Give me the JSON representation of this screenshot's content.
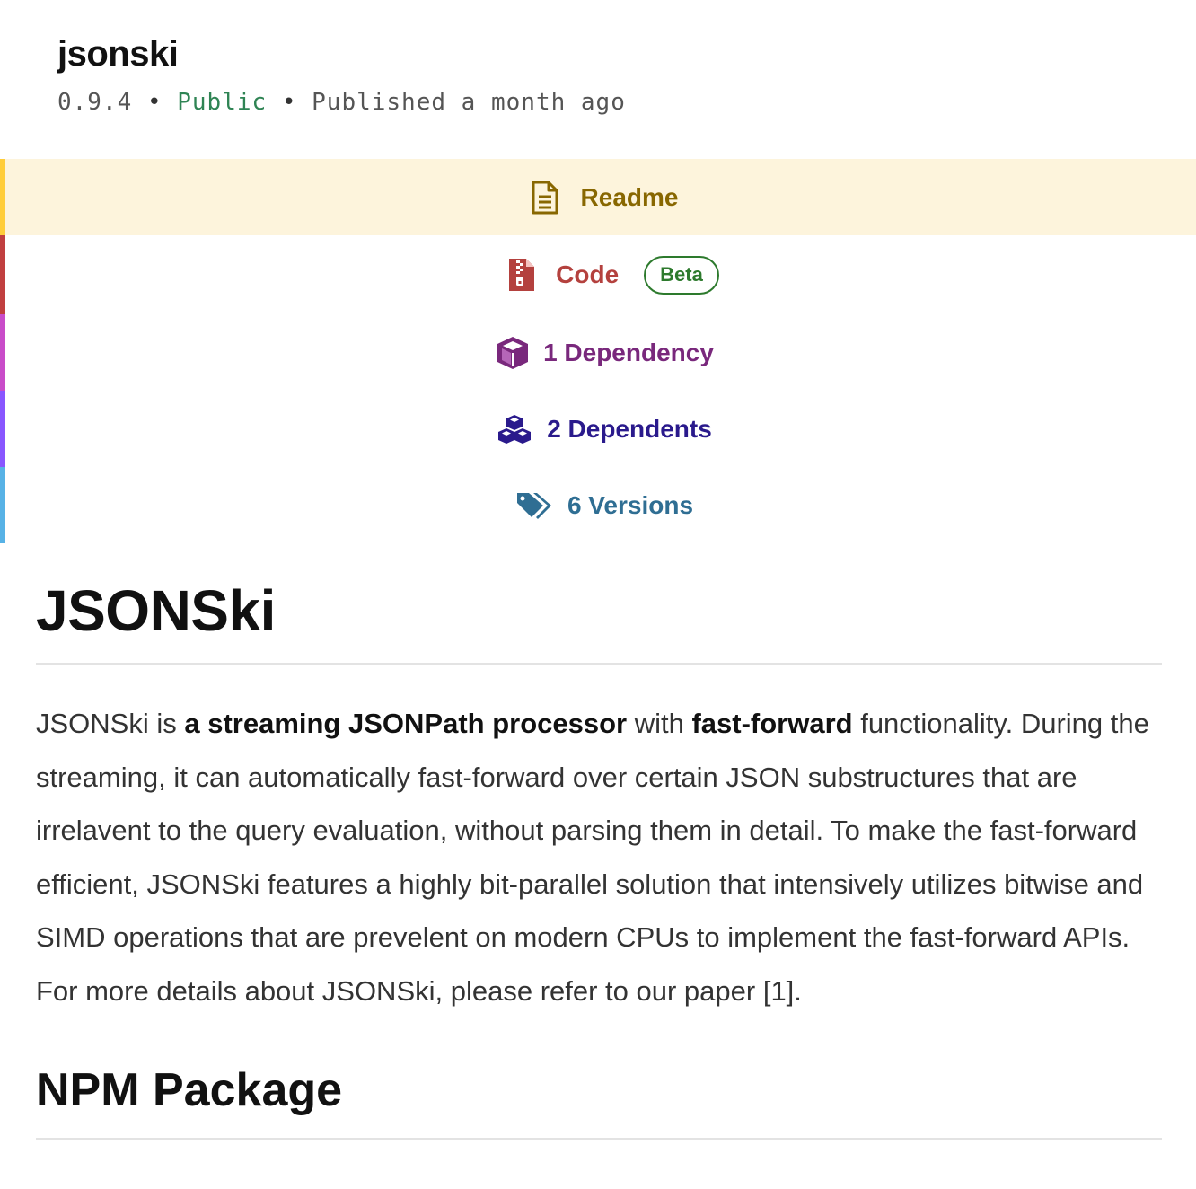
{
  "package": {
    "name": "jsonski",
    "version": "0.9.4",
    "separator": "•",
    "visibility": "Public",
    "published": "Published a month ago"
  },
  "tabs": {
    "readme": {
      "label": "Readme",
      "icon": "document-icon",
      "color": "#886701",
      "accent": "#ffcd3a"
    },
    "code": {
      "label": "Code",
      "badge": "Beta",
      "icon": "zip-file-icon",
      "color": "#b4413e",
      "accent": "#c13f3f"
    },
    "dependencies": {
      "label": "1 Dependency",
      "icon": "box-icon",
      "color": "#79287c",
      "accent": "#c94cc9"
    },
    "dependents": {
      "label": "2 Dependents",
      "icon": "boxes-icon",
      "color": "#2a1a8c",
      "accent": "#8956ff"
    },
    "versions": {
      "label": "6 Versions",
      "icon": "tags-icon",
      "color": "#2f6e93",
      "accent": "#57b2e6"
    }
  },
  "readme": {
    "heading": "JSONSki",
    "intro": {
      "p1": "JSONSki is ",
      "b1": "a streaming JSONPath processor",
      "p2": " with ",
      "b2": "fast-forward",
      "p3": " functionality. During the streaming, it can automatically fast-forward over certain JSON substructures that are irrelavent to the query evaluation, without parsing them in detail. To make the fast-forward efficient, JSONSki features a highly bit-parallel solution that intensively utilizes bitwise and SIMD operations that are prevelent on modern CPUs to implement the fast-forward APIs. For more details about JSONSki, please refer to our paper [1]."
    },
    "subheading": "NPM Package"
  }
}
